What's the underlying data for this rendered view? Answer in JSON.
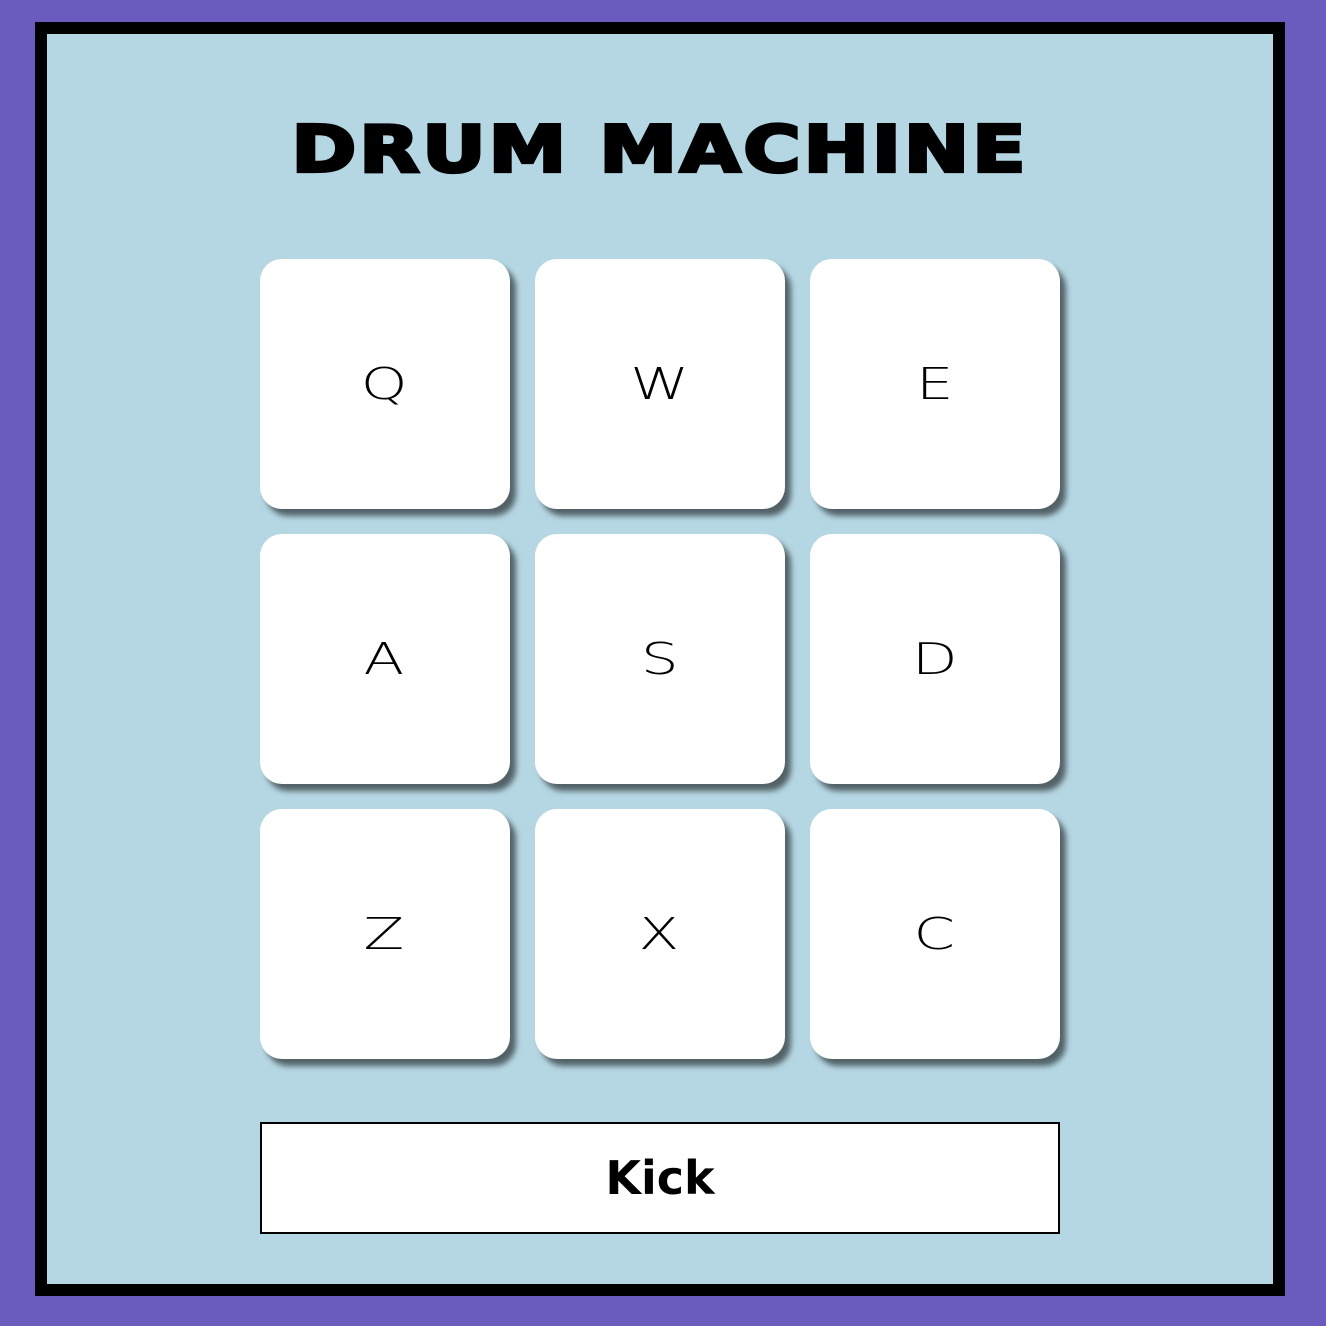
{
  "app": {
    "title": "DRUM MACHINE"
  },
  "pads": [
    {
      "key": "Q"
    },
    {
      "key": "W"
    },
    {
      "key": "E"
    },
    {
      "key": "A"
    },
    {
      "key": "S"
    },
    {
      "key": "D"
    },
    {
      "key": "Z"
    },
    {
      "key": "X"
    },
    {
      "key": "C"
    }
  ],
  "display": {
    "text": "Kick"
  },
  "colors": {
    "background": "#6a5bbf",
    "panel": "#b5d7e3",
    "pad": "#ffffff",
    "border": "#000000"
  }
}
